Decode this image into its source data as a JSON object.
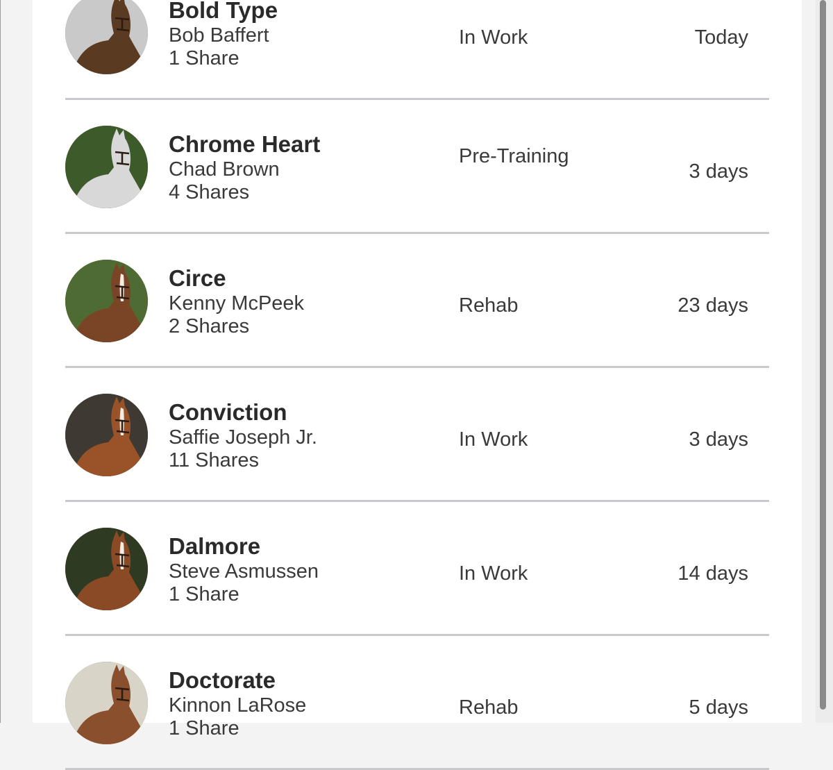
{
  "horses": [
    {
      "name": "Bold Type",
      "trainer": "Bob Baffert",
      "shares": "1 Share",
      "status": "In Work",
      "updated": "Today",
      "photo_icon": "horse-photo",
      "coat": "#5b3a22",
      "bg": "#c9c9c9",
      "blaze": false
    },
    {
      "name": "Chrome Heart",
      "trainer": "Chad Brown",
      "shares": "4 Shares",
      "status": "Pre-Training",
      "updated": "3 days",
      "photo_icon": "horse-photo",
      "coat": "#d8d8d8",
      "bg": "#3d5a2a",
      "blaze": false
    },
    {
      "name": "Circe",
      "trainer": "Kenny McPeek",
      "shares": "2 Shares",
      "status": "Rehab",
      "updated": "23 days",
      "photo_icon": "horse-photo",
      "coat": "#7a4526",
      "bg": "#4d6b33",
      "blaze": true
    },
    {
      "name": "Conviction",
      "trainer": "Saffie Joseph Jr.",
      "shares": "11 Shares",
      "status": "In Work",
      "updated": "3 days",
      "photo_icon": "horse-photo",
      "coat": "#9a5328",
      "bg": "#3e3a33",
      "blaze": true
    },
    {
      "name": "Dalmore",
      "trainer": "Steve Asmussen",
      "shares": "1 Share",
      "status": "In Work",
      "updated": "14 days",
      "photo_icon": "horse-photo",
      "coat": "#8a4a26",
      "bg": "#2f3a22",
      "blaze": true
    },
    {
      "name": "Doctorate",
      "trainer": "Kinnon LaRose",
      "shares": "1 Share",
      "status": "Rehab",
      "updated": "5 days",
      "photo_icon": "horse-photo",
      "coat": "#8a4f2c",
      "bg": "#d9d4c8",
      "blaze": false
    }
  ]
}
